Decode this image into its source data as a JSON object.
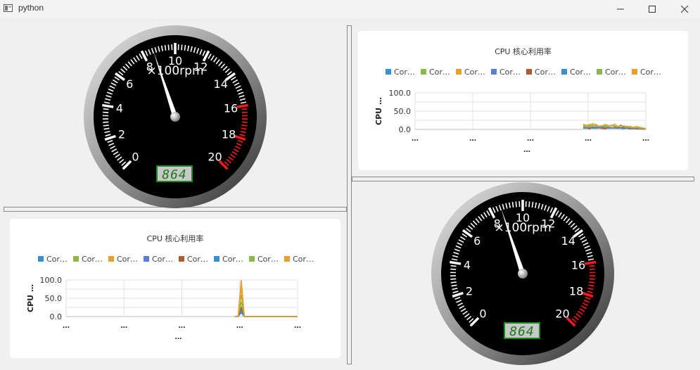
{
  "window": {
    "title": "python",
    "controls": {
      "minimize_icon": "minimize-icon",
      "maximize_icon": "maximize-icon",
      "close_icon": "close-icon"
    }
  },
  "gauges": [
    {
      "unit": "×100rpm",
      "min": 0,
      "max": 20,
      "major_step": 2,
      "redline_from": 16,
      "needle_value": 8.64,
      "display_value": "864",
      "labels": [
        "0",
        "2",
        "4",
        "6",
        "8",
        "10",
        "12",
        "14",
        "16",
        "18",
        "20"
      ]
    },
    {
      "unit": "×100rpm",
      "min": 0,
      "max": 20,
      "major_step": 2,
      "redline_from": 16,
      "needle_value": 8.64,
      "display_value": "864",
      "labels": [
        "0",
        "2",
        "4",
        "6",
        "8",
        "10",
        "12",
        "14",
        "16",
        "18",
        "20"
      ]
    }
  ],
  "colors": {
    "gauge_face": "#000000",
    "gauge_text": "#ffffff",
    "redline": "#ff1a1a",
    "lcd_bg": "#c8c8c8",
    "lcd_border": "#1a8a1a",
    "lcd_digits": "#1a7a1a",
    "series": [
      "#3a8fd0",
      "#8ab84a",
      "#e8a028",
      "#5a7fd0",
      "#b05a30",
      "#3a8fd0",
      "#8ab84a",
      "#e8a028"
    ]
  },
  "chart_data": [
    {
      "type": "line",
      "title": "CPU 核心利用率",
      "xlabel": "…",
      "ylabel": "CPU …",
      "ylim": [
        0,
        100
      ],
      "y_ticks": [
        "100.0",
        "50.0",
        "0.0"
      ],
      "x_ticks": [
        "…",
        "…",
        "…",
        "…",
        "…"
      ],
      "grid": true,
      "legend_position": "top",
      "x": [
        0,
        1,
        2,
        3,
        4,
        5,
        6,
        7,
        8,
        9,
        10,
        11,
        12,
        13,
        14,
        15,
        16,
        17,
        18,
        19,
        20
      ],
      "series": [
        {
          "name": "Cor…",
          "values": [
            6,
            5,
            4,
            7,
            6,
            5,
            4,
            5,
            6,
            4,
            5,
            3,
            4,
            6,
            5,
            4,
            3,
            5,
            4,
            3,
            2
          ]
        },
        {
          "name": "Cor…",
          "values": [
            10,
            8,
            12,
            9,
            14,
            8,
            6,
            10,
            7,
            12,
            9,
            6,
            8,
            7,
            9,
            6,
            5,
            8,
            6,
            4,
            2
          ]
        },
        {
          "name": "Cor…",
          "values": [
            14,
            12,
            10,
            16,
            12,
            9,
            8,
            14,
            11,
            9,
            15,
            8,
            10,
            9,
            7,
            8,
            6,
            7,
            5,
            4,
            2
          ]
        },
        {
          "name": "Cor…",
          "values": [
            4,
            3,
            5,
            4,
            3,
            6,
            4,
            3,
            4,
            5,
            3,
            4,
            3,
            2,
            4,
            3,
            2,
            3,
            2,
            2,
            1
          ]
        },
        {
          "name": "Cor…",
          "values": [
            3,
            4,
            2,
            5,
            3,
            4,
            3,
            2,
            4,
            3,
            5,
            3,
            12,
            4,
            3,
            2,
            3,
            2,
            2,
            1,
            1
          ]
        },
        {
          "name": "Cor…",
          "values": [
            5,
            4,
            6,
            3,
            5,
            4,
            6,
            5,
            3,
            4,
            5,
            6,
            4,
            3,
            5,
            4,
            3,
            4,
            3,
            2,
            2
          ]
        },
        {
          "name": "Cor…",
          "values": [
            8,
            10,
            7,
            12,
            9,
            8,
            11,
            7,
            9,
            10,
            8,
            7,
            9,
            8,
            6,
            7,
            5,
            6,
            4,
            3,
            2
          ]
        },
        {
          "name": "Cor…",
          "values": [
            12,
            9,
            14,
            10,
            13,
            8,
            10,
            12,
            9,
            11,
            10,
            9,
            8,
            10,
            7,
            6,
            5,
            6,
            4,
            3,
            2
          ]
        }
      ]
    },
    {
      "type": "line",
      "title": "CPU 核心利用率",
      "xlabel": "…",
      "ylabel": "CPU …",
      "ylim": [
        0,
        100
      ],
      "y_ticks": [
        "100.0",
        "50.0",
        "0.0"
      ],
      "x_ticks": [
        "…",
        "…",
        "…",
        "…",
        "…"
      ],
      "grid": true,
      "legend_position": "top",
      "x": [
        0,
        1,
        2,
        3,
        4,
        5,
        6,
        7,
        8,
        9,
        10,
        11,
        12,
        13,
        14,
        15,
        16,
        17,
        18,
        19,
        20
      ],
      "series": [
        {
          "name": "Cor…",
          "values": [
            0,
            0,
            20,
            0,
            0,
            0,
            0,
            0,
            0,
            0,
            0,
            0,
            0,
            0,
            0,
            0,
            0,
            0,
            0,
            0,
            0
          ]
        },
        {
          "name": "Cor…",
          "values": [
            0,
            0,
            60,
            0,
            0,
            0,
            0,
            0,
            0,
            0,
            0,
            0,
            0,
            0,
            0,
            0,
            0,
            0,
            0,
            0,
            0
          ]
        },
        {
          "name": "Cor…",
          "values": [
            0,
            0,
            100,
            0,
            0,
            0,
            0,
            0,
            0,
            0,
            0,
            0,
            0,
            0,
            0,
            0,
            0,
            0,
            0,
            0,
            0
          ]
        },
        {
          "name": "Cor…",
          "values": [
            0,
            0,
            15,
            0,
            0,
            0,
            0,
            0,
            0,
            0,
            0,
            0,
            0,
            0,
            0,
            0,
            0,
            0,
            0,
            0,
            0
          ]
        },
        {
          "name": "Cor…",
          "values": [
            0,
            0,
            25,
            0,
            0,
            0,
            0,
            0,
            0,
            0,
            0,
            0,
            0,
            0,
            0,
            0,
            0,
            0,
            0,
            0,
            0
          ]
        },
        {
          "name": "Cor…",
          "values": [
            0,
            0,
            10,
            0,
            0,
            0,
            0,
            0,
            0,
            0,
            0,
            0,
            0,
            0,
            0,
            0,
            0,
            0,
            0,
            0,
            0
          ]
        },
        {
          "name": "Cor…",
          "values": [
            0,
            0,
            40,
            0,
            0,
            0,
            0,
            0,
            0,
            0,
            0,
            0,
            0,
            0,
            0,
            0,
            0,
            0,
            0,
            0,
            0
          ]
        },
        {
          "name": "Cor…",
          "values": [
            0,
            0,
            80,
            0,
            0,
            0,
            0,
            0,
            0,
            0,
            0,
            0,
            0,
            0,
            0,
            0,
            0,
            0,
            0,
            0,
            0
          ]
        }
      ]
    }
  ]
}
